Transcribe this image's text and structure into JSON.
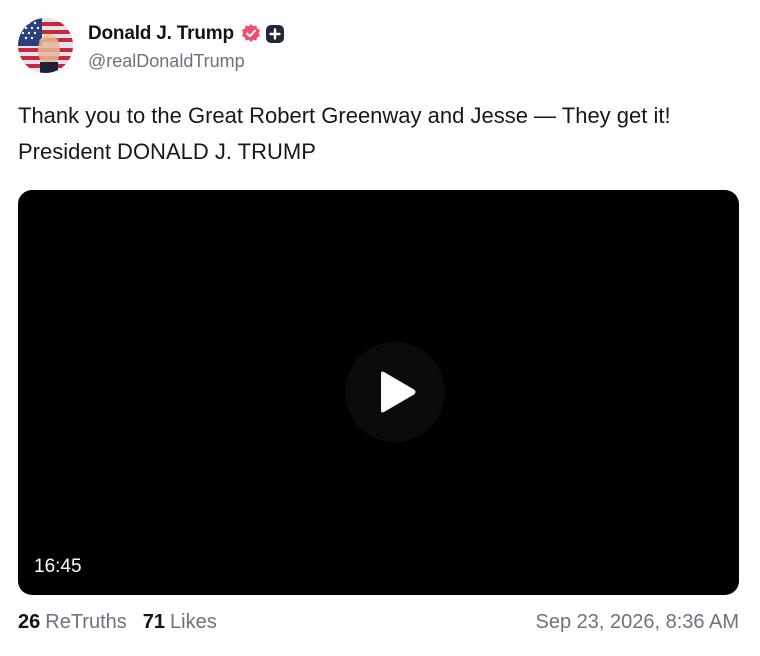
{
  "author": {
    "display_name": "Donald J. Trump",
    "handle": "@realDonaldTrump",
    "verified_badge_color": "#f34e6d"
  },
  "post": {
    "text": "Thank you to the Great Robert Greenway and Jesse — They get it! President DONALD J. TRUMP"
  },
  "video": {
    "duration": "16:45"
  },
  "stats": {
    "retruths_count": "26",
    "retruths_label": "ReTruths",
    "likes_count": "71",
    "likes_label": "Likes"
  },
  "timestamp": "Sep 23, 2026, 8:36 AM"
}
